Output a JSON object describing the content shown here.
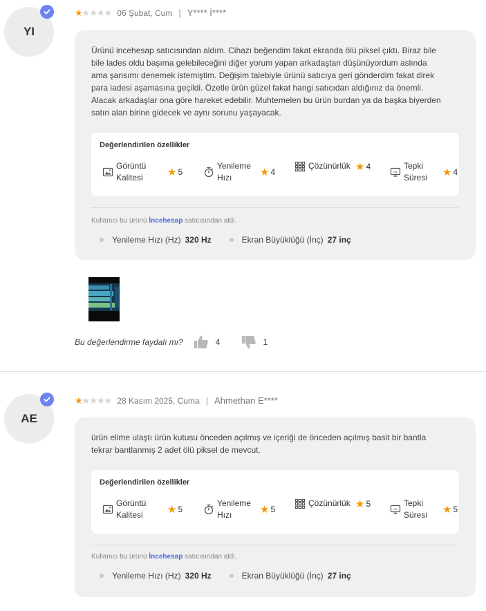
{
  "colors": {
    "star": "#f29900",
    "star_off": "#d4d4d4",
    "link": "#4a6ee0",
    "verified": "#6b84f0"
  },
  "reviews": [
    {
      "initials": "YI",
      "rating": 1,
      "date": "06 Şubat, Cum",
      "author": "Y**** İ****",
      "text": "Ürünü incehesap satıcısından aldım. Cihazı beğendim fakat ekranda ölü piksel çıktı. Biraz bile bile lades oldu başıma gelebileceğini diğer yorum yapan arkadaştan düşünüyordum aslında ama şansımı denemek istemiştim. Değişim talebiyle ürünü satıcıya geri gönderdim fakat direk para iadesi aşamasına geçildi. Özetle ürün güzel fakat hangi satıcıdan aldığınız da önemli. Alacak arkadaşlar ona göre hareket edebilir.  Muhtemelen bu ürün burdan ya da başka biyerden satın alan birine gidecek ve aynı sorunu yaşayacak.",
      "features_title": "Değerlendirilen özellikler",
      "features": [
        {
          "icon": "image-quality-icon",
          "label_1": "Görüntü",
          "label_2": "Kalitesi",
          "score": "5"
        },
        {
          "icon": "stopwatch-icon",
          "label_1": "Yenileme",
          "label_2": "Hızı",
          "score": "4"
        },
        {
          "icon": "grid-icon",
          "label_1": "Çözünürlük",
          "label_2": "",
          "score": "4"
        },
        {
          "icon": "monitor-icon",
          "label_1": "Tepki",
          "label_2": "Süresi",
          "score": "4"
        }
      ],
      "seller_prefix": "Kullanıcı bu ürünü",
      "seller_name": "İncehesap",
      "seller_suffix": "satıcısından aldı.",
      "attributes": [
        {
          "label": "Yenileme Hızı (Hz)",
          "value": "320 Hz"
        },
        {
          "label": "Ekran Büyüklüğü (İnç)",
          "value": "27 inç"
        }
      ],
      "helpful_question": "Bu değerlendirme faydalı mı?",
      "likes": "4",
      "dislikes": "1"
    },
    {
      "initials": "AE",
      "rating": 1,
      "date": "28 Kasım 2025, Cuma",
      "author": "Ahmethan E****",
      "text": "ürün elime ulaştı ürün kutusu önceden açılmış ve içeriği de önceden açılmış basit bir bantla tekrar bantlanmış 2 adet ölü piksel de mevcut.",
      "features_title": "Değerlendirilen özellikler",
      "features": [
        {
          "icon": "image-quality-icon",
          "label_1": "Görüntü",
          "label_2": "Kalitesi",
          "score": "5"
        },
        {
          "icon": "stopwatch-icon",
          "label_1": "Yenileme",
          "label_2": "Hızı",
          "score": "5"
        },
        {
          "icon": "grid-icon",
          "label_1": "Çözünürlük",
          "label_2": "",
          "score": "5"
        },
        {
          "icon": "monitor-icon",
          "label_1": "Tepki",
          "label_2": "Süresi",
          "score": "5"
        }
      ],
      "seller_prefix": "Kullanıcı bu ürünü",
      "seller_name": "İncehesap",
      "seller_suffix": "satıcısından aldı.",
      "attributes": [
        {
          "label": "Yenileme Hızı (Hz)",
          "value": "320 Hz"
        },
        {
          "label": "Ekran Büyüklüğü (İnç)",
          "value": "27 inç"
        }
      ]
    }
  ]
}
